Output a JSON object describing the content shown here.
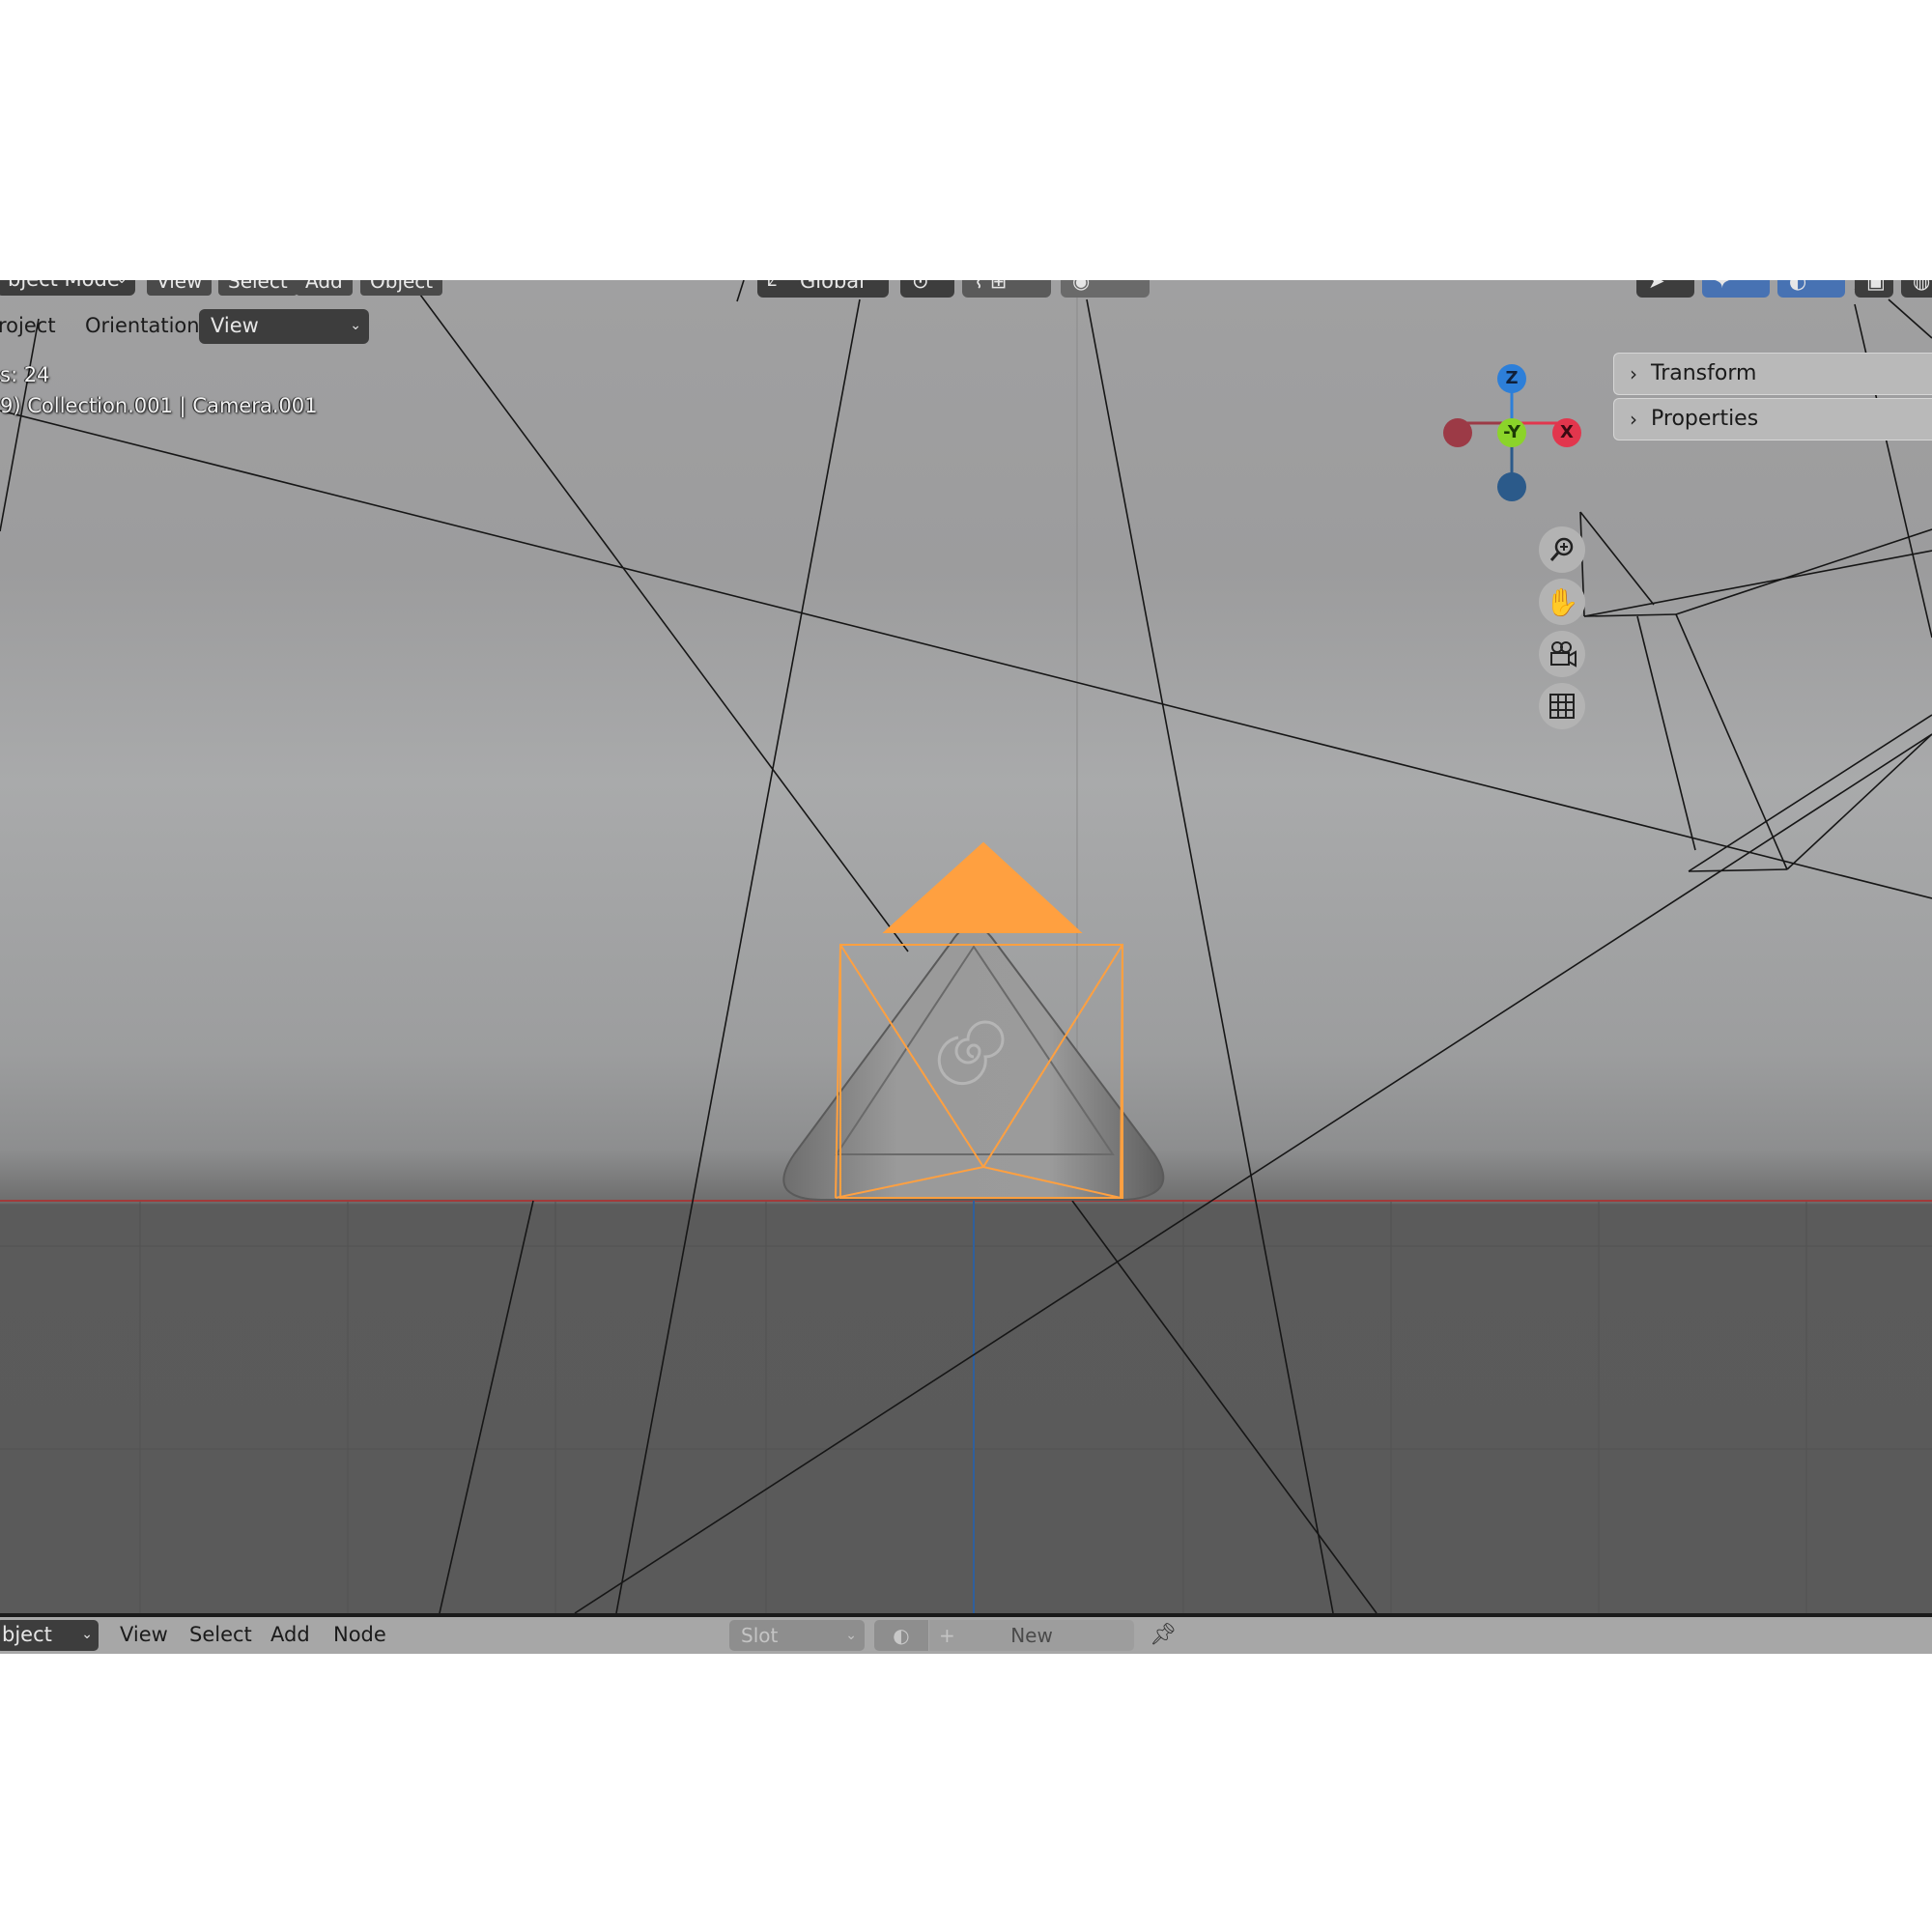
{
  "header": {
    "mode_label": "bject Mode",
    "menu": [
      "View",
      "Select",
      "Add",
      "Object"
    ],
    "transform_orientation": "Global"
  },
  "tool_settings": {
    "tool_label": "roject",
    "orientation_label": "Orientation:",
    "orientation_value": "View"
  },
  "overlay_info": {
    "line1": "s: 24",
    "line2": "9) Collection.001 | Camera.001"
  },
  "gizmo": {
    "z_label": "Z",
    "y_label": "-Y",
    "x_label": "X",
    "colors": {
      "x": "#e2364d",
      "y": "#8bd42a",
      "z": "#2d7fd9"
    }
  },
  "sidebar": {
    "tabs": [
      "Transform",
      "Properties"
    ]
  },
  "nav_icons": [
    "zoom-icon",
    "hand-pan-icon",
    "camera-view-icon",
    "grid-icon"
  ],
  "selection_color": "#ffa040",
  "bottom_bar": {
    "mode_label": "bject",
    "menu": [
      "View",
      "Select",
      "Add",
      "Node"
    ],
    "slot_label": "Slot",
    "new_label": "New"
  }
}
